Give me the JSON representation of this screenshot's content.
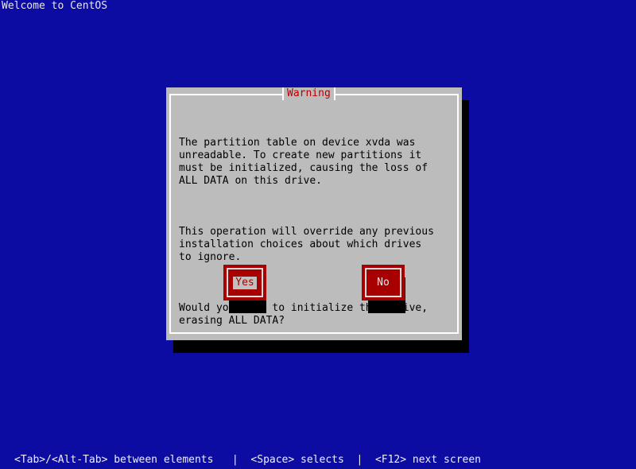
{
  "screen": {
    "title": "Welcome to CentOS"
  },
  "dialog": {
    "title": "Warning",
    "paragraphs": [
      "The partition table on device xvda was\nunreadable. To create new partitions it\nmust be initialized, causing the loss of\nALL DATA on this drive.",
      "This operation will override any previous\ninstallation choices about which drives\nto ignore.",
      "Would you like to initialize this drive,\nerasing ALL DATA?"
    ],
    "buttons": {
      "yes": "Yes",
      "no": "No"
    },
    "focused_button": "Yes"
  },
  "status_bar": {
    "text": "<Tab>/<Alt-Tab> between elements   |  <Space> selects  |  <F12> next screen"
  },
  "colors": {
    "background": "#0c0ca3",
    "dialog": "#bcbcbc",
    "title": "#b40000",
    "button": "#a80000",
    "shadow": "#000000"
  }
}
